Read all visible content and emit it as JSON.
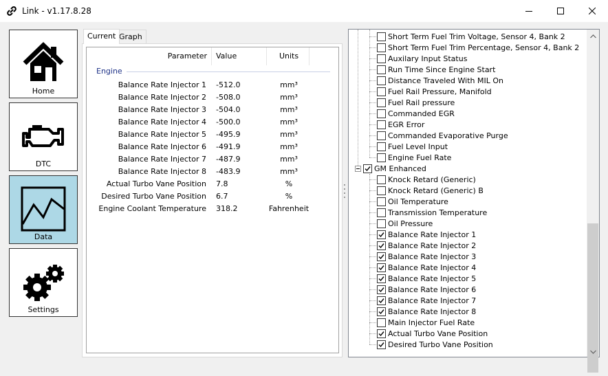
{
  "window": {
    "title": "Link - v1.17.8.28",
    "icons": {
      "app": "link-icon",
      "minimize": "minimize-icon",
      "maximize": "maximize-icon",
      "close": "close-icon"
    }
  },
  "nav": [
    {
      "label": "Home",
      "icon": "home-icon"
    },
    {
      "label": "DTC",
      "icon": "engine-icon"
    },
    {
      "label": "Data",
      "icon": "chart-icon",
      "active": true
    },
    {
      "label": "Settings",
      "icon": "gears-icon"
    }
  ],
  "tabs": [
    {
      "label": "Current",
      "active": true
    },
    {
      "label": "Graph",
      "active": false
    }
  ],
  "grid": {
    "headers": {
      "parameter": "Parameter",
      "value": "Value",
      "units": "Units"
    },
    "group": "Engine",
    "rows": [
      {
        "parameter": "Balance Rate Injector 1",
        "value": "-512.0",
        "units": "mm³"
      },
      {
        "parameter": "Balance Rate Injector 2",
        "value": "-508.0",
        "units": "mm³"
      },
      {
        "parameter": "Balance Rate Injector 3",
        "value": "-504.0",
        "units": "mm³"
      },
      {
        "parameter": "Balance Rate Injector 4",
        "value": "-500.0",
        "units": "mm³"
      },
      {
        "parameter": "Balance Rate Injector 5",
        "value": "-495.9",
        "units": "mm³"
      },
      {
        "parameter": "Balance Rate Injector 6",
        "value": "-491.9",
        "units": "mm³"
      },
      {
        "parameter": "Balance Rate Injector 7",
        "value": "-487.9",
        "units": "mm³"
      },
      {
        "parameter": "Balance Rate Injector 8",
        "value": "-483.9",
        "units": "mm³"
      },
      {
        "parameter": "Actual Turbo Vane Position",
        "value": "7.8",
        "units": "%"
      },
      {
        "parameter": "Desired Turbo Vane Position",
        "value": "6.7",
        "units": "%"
      },
      {
        "parameter": "Engine Coolant Temperature",
        "value": "318.2",
        "units": "Fahrenheit"
      }
    ]
  },
  "tree": {
    "items_before": [
      {
        "label": "Short Term Fuel Trim Voltage, Sensor 4, Bank 2",
        "checked": false
      },
      {
        "label": "Short Term Fuel Trim Percentage, Sensor 4, Bank 2",
        "checked": false
      },
      {
        "label": "Auxilary Input Status",
        "checked": false
      },
      {
        "label": "Run Time Since Engine Start",
        "checked": false
      },
      {
        "label": "Distance Traveled With MIL On",
        "checked": false
      },
      {
        "label": "Fuel Rail Pressure, Manifold",
        "checked": false
      },
      {
        "label": "Fuel Rail pressure",
        "checked": false
      },
      {
        "label": "Commanded EGR",
        "checked": false
      },
      {
        "label": "EGR Error",
        "checked": false
      },
      {
        "label": "Commanded Evaporative Purge",
        "checked": false
      },
      {
        "label": "Fuel Level Input",
        "checked": false
      },
      {
        "label": "Engine Fuel Rate",
        "checked": false
      }
    ],
    "group": {
      "label": "GM Enhanced",
      "checked": true,
      "expanded": true
    },
    "items_after": [
      {
        "label": "Knock Retard (Generic)",
        "checked": false
      },
      {
        "label": "Knock Retard (Generic) B",
        "checked": false
      },
      {
        "label": "Oil Temperature",
        "checked": false
      },
      {
        "label": "Transmission Temperature",
        "checked": false
      },
      {
        "label": "Oil Pressure",
        "checked": false
      },
      {
        "label": "Balance Rate Injector 1",
        "checked": true
      },
      {
        "label": "Balance Rate Injector 2",
        "checked": true
      },
      {
        "label": "Balance Rate Injector 3",
        "checked": true
      },
      {
        "label": "Balance Rate Injector 4",
        "checked": true
      },
      {
        "label": "Balance Rate Injector 5",
        "checked": true
      },
      {
        "label": "Balance Rate Injector 6",
        "checked": true
      },
      {
        "label": "Balance Rate Injector 7",
        "checked": true
      },
      {
        "label": "Balance Rate Injector 8",
        "checked": true
      },
      {
        "label": "Main Injector Fuel Rate",
        "checked": false
      },
      {
        "label": "Actual Turbo Vane Position",
        "checked": true
      },
      {
        "label": "Desired Turbo Vane Position",
        "checked": true
      }
    ]
  }
}
